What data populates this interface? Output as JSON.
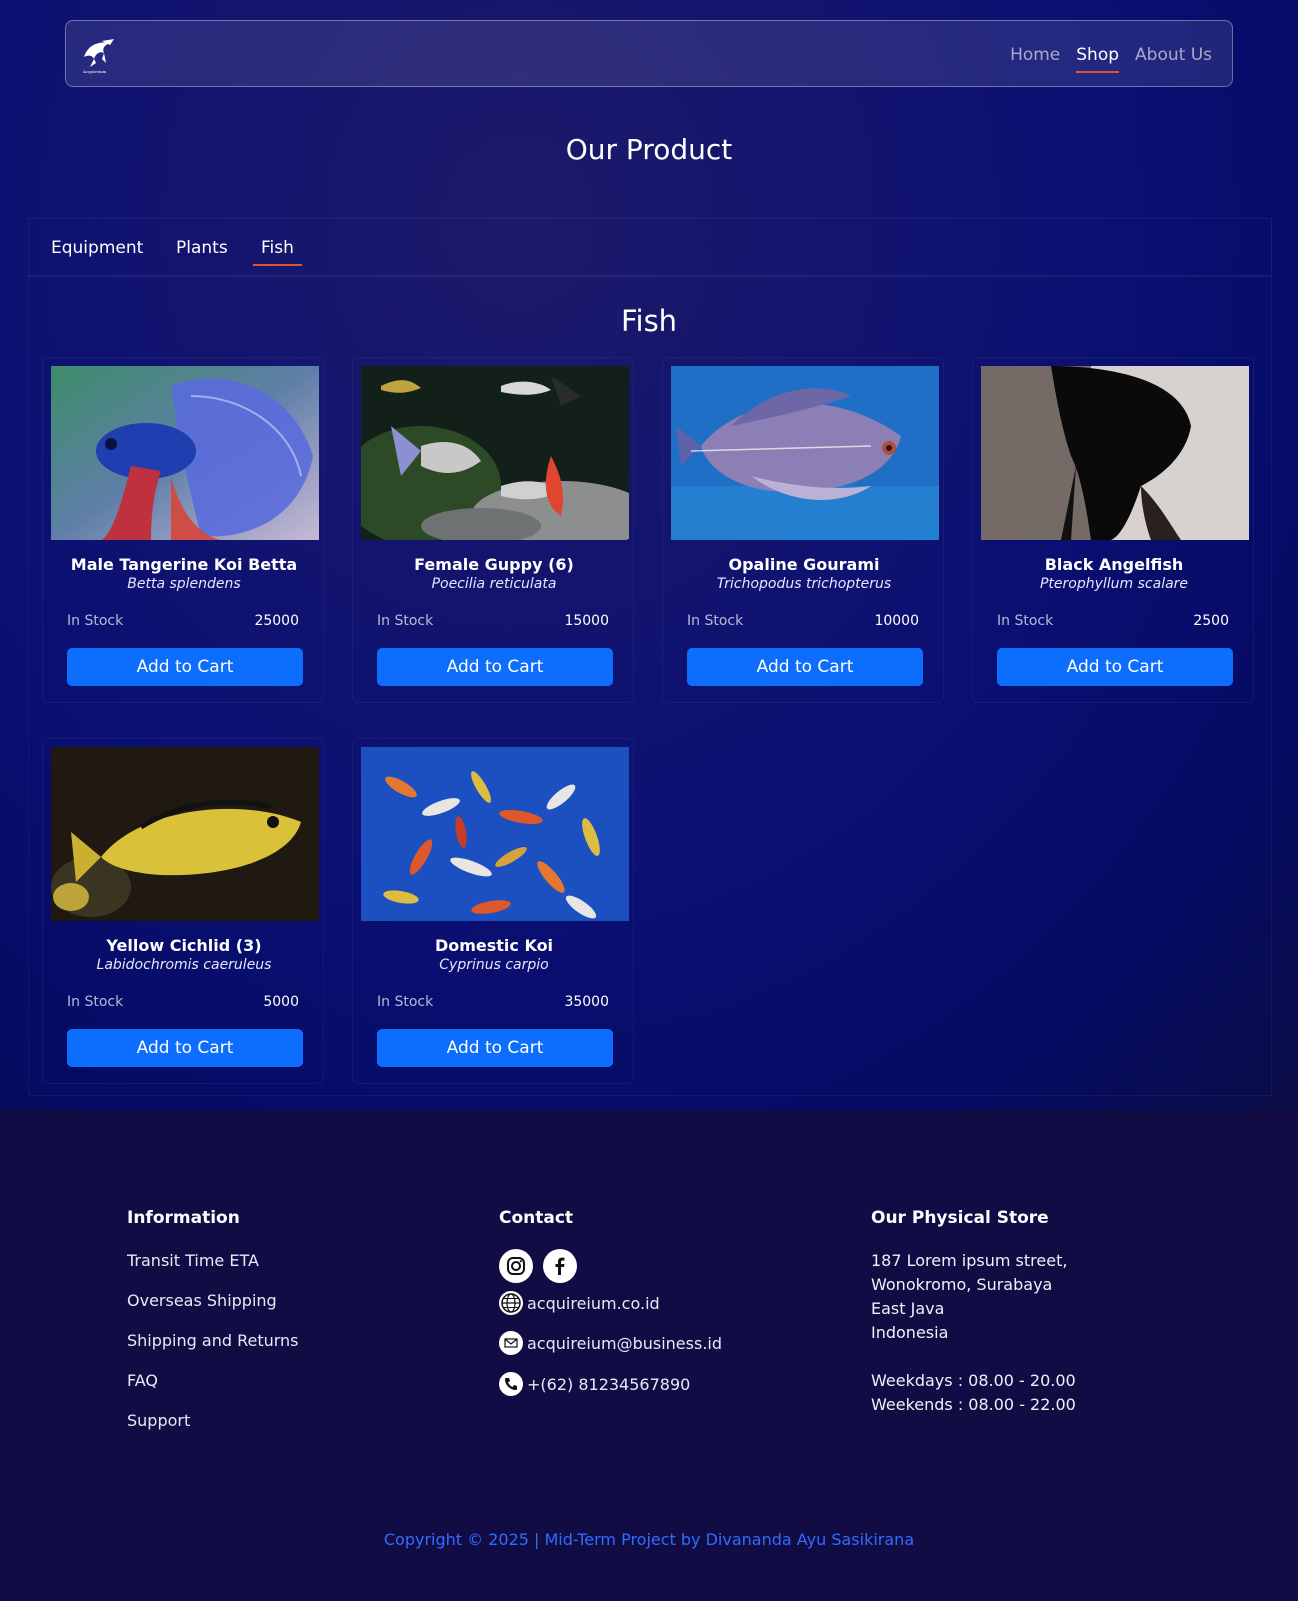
{
  "nav": {
    "logo_text": "Acquireium",
    "links": [
      {
        "label": "Home",
        "active": false
      },
      {
        "label": "Shop",
        "active": true
      },
      {
        "label": "About Us",
        "active": false
      }
    ]
  },
  "page_title": "Our Product",
  "tabs": [
    {
      "label": "Equipment",
      "active": false
    },
    {
      "label": "Plants",
      "active": false
    },
    {
      "label": "Fish",
      "active": true
    }
  ],
  "section_title": "Fish",
  "products": [
    {
      "name": "Male Tangerine Koi Betta",
      "scientific": "Betta splendens",
      "stock": "In Stock",
      "price": "25000",
      "button": "Add to Cart"
    },
    {
      "name": "Female Guppy (6)",
      "scientific": "Poecilia reticulata",
      "stock": "In Stock",
      "price": "15000",
      "button": "Add to Cart"
    },
    {
      "name": "Opaline Gourami",
      "scientific": "Trichopodus trichopterus",
      "stock": "In Stock",
      "price": "10000",
      "button": "Add to Cart"
    },
    {
      "name": "Black Angelfish",
      "scientific": "Pterophyllum scalare",
      "stock": "In Stock",
      "price": "2500",
      "button": "Add to Cart"
    },
    {
      "name": "Yellow Cichlid (3)",
      "scientific": "Labidochromis caeruleus",
      "stock": "In Stock",
      "price": "5000",
      "button": "Add to Cart"
    },
    {
      "name": "Domestic Koi",
      "scientific": "Cyprinus carpio",
      "stock": "In Stock",
      "price": "35000",
      "button": "Add to Cart"
    }
  ],
  "footer": {
    "information": {
      "title": "Information",
      "links": [
        "Transit Time ETA",
        "Overseas Shipping",
        "Shipping and Returns",
        "FAQ",
        "Support"
      ]
    },
    "contact": {
      "title": "Contact",
      "social_icons": [
        "instagram-icon",
        "facebook-icon"
      ],
      "website": "acquireium.co.id",
      "email": "acquireium@business.id",
      "phone": "+(62) 81234567890"
    },
    "store": {
      "title": "Our Physical Store",
      "address": [
        "187 Lorem ipsum street,",
        "Wonokromo, Surabaya",
        "East Java",
        "Indonesia"
      ],
      "hours": [
        "Weekdays : 08.00 - 20.00",
        "Weekends : 08.00 - 22.00"
      ]
    },
    "copyright": "Copyright © 2025 | Mid-Term Project by Divananda Ayu Sasikirana"
  },
  "colors": {
    "accent": "#0d6efd",
    "active_underline": "#e0542c",
    "footer_bg": "#120c45",
    "copyright": "#2f6cff"
  }
}
